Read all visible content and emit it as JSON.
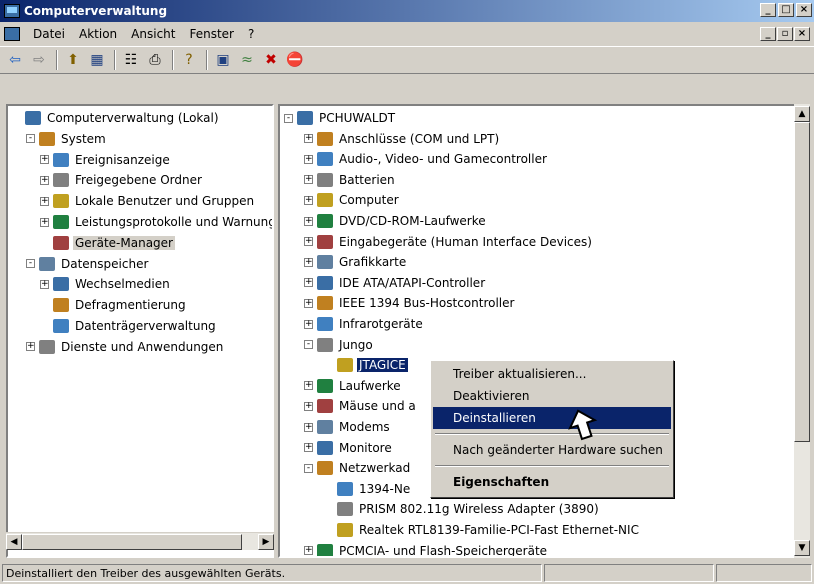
{
  "window": {
    "title": "Computerverwaltung"
  },
  "menus": [
    "Datei",
    "Aktion",
    "Ansicht",
    "Fenster",
    "?"
  ],
  "toolbar": [
    "back-icon",
    "forward-icon",
    "up-icon",
    "console-tree-icon",
    "properties-icon",
    "print-icon",
    "help-icon",
    "scan-icon",
    "update-driver-icon",
    "disable-icon",
    "uninstall-icon"
  ],
  "left_tree": [
    {
      "label": "Computerverwaltung (Lokal)",
      "level": 0,
      "exp": "",
      "icon": "computer-icon"
    },
    {
      "label": "System",
      "level": 1,
      "exp": "-",
      "icon": "system-icon"
    },
    {
      "label": "Ereignisanzeige",
      "level": 2,
      "exp": "+",
      "icon": "event-viewer-icon"
    },
    {
      "label": "Freigegebene Ordner",
      "level": 2,
      "exp": "+",
      "icon": "shared-folders-icon"
    },
    {
      "label": "Lokale Benutzer und Gruppen",
      "level": 2,
      "exp": "+",
      "icon": "users-icon"
    },
    {
      "label": "Leistungsprotokolle und Warnungen",
      "level": 2,
      "exp": "+",
      "icon": "performance-icon"
    },
    {
      "label": "Geräte-Manager",
      "level": 2,
      "exp": "",
      "icon": "device-manager-icon",
      "selected": true
    },
    {
      "label": "Datenspeicher",
      "level": 1,
      "exp": "-",
      "icon": "storage-icon"
    },
    {
      "label": "Wechselmedien",
      "level": 2,
      "exp": "+",
      "icon": "removable-media-icon"
    },
    {
      "label": "Defragmentierung",
      "level": 2,
      "exp": "",
      "icon": "defrag-icon"
    },
    {
      "label": "Datenträgerverwaltung",
      "level": 2,
      "exp": "",
      "icon": "disk-management-icon"
    },
    {
      "label": "Dienste und Anwendungen",
      "level": 1,
      "exp": "+",
      "icon": "services-icon"
    }
  ],
  "right_tree": [
    {
      "label": "PCHUWALDT",
      "level": 0,
      "exp": "-",
      "icon": "computer-icon"
    },
    {
      "label": "Anschlüsse (COM und LPT)",
      "level": 1,
      "exp": "+",
      "icon": "port-icon"
    },
    {
      "label": "Audio-, Video- und Gamecontroller",
      "level": 1,
      "exp": "+",
      "icon": "audio-icon"
    },
    {
      "label": "Batterien",
      "level": 1,
      "exp": "+",
      "icon": "battery-icon"
    },
    {
      "label": "Computer",
      "level": 1,
      "exp": "+",
      "icon": "computer-icon"
    },
    {
      "label": "DVD/CD-ROM-Laufwerke",
      "level": 1,
      "exp": "+",
      "icon": "cdrom-icon"
    },
    {
      "label": "Eingabegeräte (Human Interface Devices)",
      "level": 1,
      "exp": "+",
      "icon": "hid-icon"
    },
    {
      "label": "Grafikkarte",
      "level": 1,
      "exp": "+",
      "icon": "display-adapter-icon"
    },
    {
      "label": "IDE ATA/ATAPI-Controller",
      "level": 1,
      "exp": "+",
      "icon": "ide-icon"
    },
    {
      "label": "IEEE 1394 Bus-Hostcontroller",
      "level": 1,
      "exp": "+",
      "icon": "firewire-icon"
    },
    {
      "label": "Infrarotgeräte",
      "level": 1,
      "exp": "+",
      "icon": "infrared-icon"
    },
    {
      "label": "Jungo",
      "level": 1,
      "exp": "-",
      "icon": "jungo-icon"
    },
    {
      "label": "JTAGICE",
      "level": 2,
      "exp": "",
      "icon": "jtag-icon",
      "selected": true
    },
    {
      "label": "Laufwerke",
      "level": 1,
      "exp": "+",
      "icon": "drive-icon"
    },
    {
      "label": "Mäuse und a",
      "level": 1,
      "exp": "+",
      "icon": "mouse-icon"
    },
    {
      "label": "Modems",
      "level": 1,
      "exp": "+",
      "icon": "modem-icon"
    },
    {
      "label": "Monitore",
      "level": 1,
      "exp": "+",
      "icon": "monitor-icon"
    },
    {
      "label": "Netzwerkad",
      "level": 1,
      "exp": "-",
      "icon": "network-icon"
    },
    {
      "label": "1394-Ne",
      "level": 2,
      "exp": "",
      "icon": "network-card-icon"
    },
    {
      "label": "PRISM 802.11g Wireless Adapter (3890)",
      "level": 2,
      "exp": "",
      "icon": "network-card-icon"
    },
    {
      "label": "Realtek RTL8139-Familie-PCI-Fast Ethernet-NIC",
      "level": 2,
      "exp": "",
      "icon": "network-card-icon"
    },
    {
      "label": "PCMCIA- und Flash-Speichergeräte",
      "level": 1,
      "exp": "+",
      "icon": "pcmcia-icon"
    }
  ],
  "context_menu": [
    {
      "label": "Treiber aktualisieren...",
      "bold": false
    },
    {
      "label": "Deaktivieren",
      "bold": false
    },
    {
      "label": "Deinstallieren",
      "bold": false,
      "highlighted": true
    },
    {
      "sep": true
    },
    {
      "label": "Nach geänderter Hardware suchen",
      "bold": false
    },
    {
      "sep": true
    },
    {
      "label": "Eigenschaften",
      "bold": true
    }
  ],
  "status": {
    "text": "Deinstalliert den Treiber des ausgewählten Geräts."
  },
  "colors": {
    "titlebar": "#0a246a",
    "selection": "#0a246a",
    "face": "#d4d0c8"
  }
}
